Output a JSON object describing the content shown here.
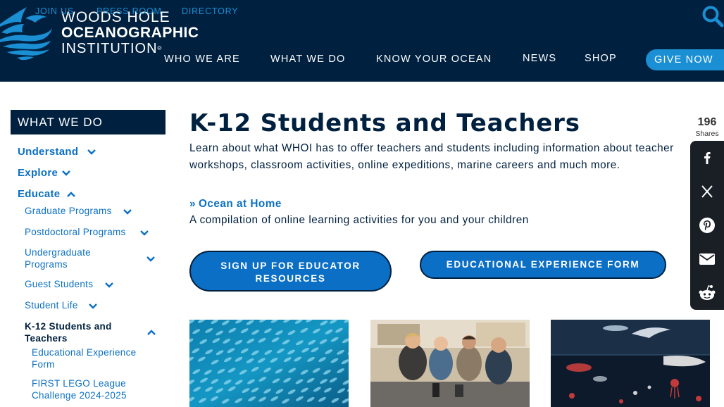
{
  "header": {
    "logo": {
      "line1": "WOODS HOLE",
      "line2": "OCEANOGRAPHIC",
      "line3": "INSTITUTION",
      "reg": "®"
    },
    "utility_links": [
      "JOIN US",
      "PRESS ROOM",
      "DIRECTORY"
    ],
    "nav": [
      "WHO WE ARE",
      "WHAT WE DO",
      "KNOW YOUR OCEAN",
      "NEWS",
      "SHOP"
    ],
    "give_label": "GIVE NOW"
  },
  "sidebar": {
    "heading": "WHAT WE DO",
    "items": [
      {
        "label": "Understand",
        "level": 1,
        "chevron": "chevron-down-icon"
      },
      {
        "label": "Explore",
        "level": 1,
        "chevron": "chevron-down-icon"
      },
      {
        "label": "Educate",
        "level": 1,
        "chevron": "chevron-up-icon"
      },
      {
        "label": "Graduate Programs",
        "level": 2,
        "chevron": "chevron-down-icon"
      },
      {
        "label": "Postdoctoral Programs",
        "level": 2,
        "chevron": "chevron-down-icon"
      },
      {
        "label": "Undergraduate Programs",
        "level": 2,
        "chevron": "chevron-down-icon"
      },
      {
        "label": "Guest Students",
        "level": 2,
        "chevron": "chevron-down-icon"
      },
      {
        "label": "Student Life",
        "level": 2,
        "chevron": "chevron-down-icon"
      },
      {
        "label": "K-12 Students and Teachers",
        "level": 2,
        "chevron": "chevron-up-icon",
        "active": true
      },
      {
        "label": "Educational Experience Form",
        "level": 3
      },
      {
        "label": "FIRST LEGO League Challenge 2024-2025",
        "level": 3
      }
    ]
  },
  "main": {
    "title": "K-12 Students and Teachers",
    "intro": "Learn about what WHOI has to offer teachers and students including information about teacher workshops, classroom activities, online expeditions, marine careers and much more.",
    "home_link": "Ocean at Home",
    "home_desc": "A compilation of online learning activities for you and your children",
    "cta_signup": "SIGN UP FOR EDUCATOR RESOURCES",
    "cta_form": "EDUCATIONAL EXPERIENCE FORM"
  },
  "share": {
    "count": "196",
    "label": "Shares",
    "buttons": [
      "facebook-icon",
      "x-icon",
      "pinterest-icon",
      "email-icon",
      "reddit-icon"
    ]
  },
  "colors": {
    "navy": "#00203f",
    "link_blue": "#0b70c4",
    "accent_blue": "#1a8fd4",
    "cta_blue": "#0b6fc5",
    "share_bg": "#1a1f26"
  }
}
